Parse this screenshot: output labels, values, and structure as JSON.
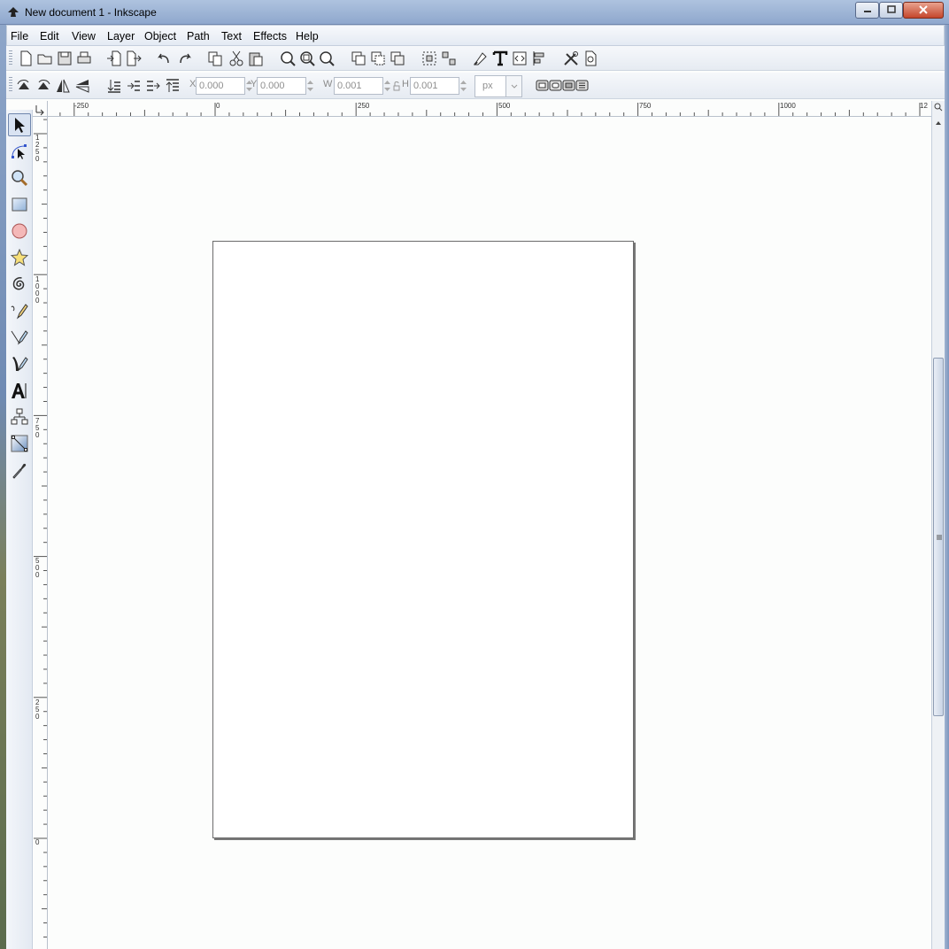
{
  "window": {
    "title": "New document 1 - Inkscape"
  },
  "menu": [
    {
      "label": "File",
      "mnemonic": "F"
    },
    {
      "label": "Edit",
      "mnemonic": "E"
    },
    {
      "label": "View",
      "mnemonic": "V"
    },
    {
      "label": "Layer",
      "mnemonic": "L"
    },
    {
      "label": "Object",
      "mnemonic": "O"
    },
    {
      "label": "Path",
      "mnemonic": "P"
    },
    {
      "label": "Text",
      "mnemonic": "T"
    },
    {
      "label": "Effects",
      "mnemonic": "c"
    },
    {
      "label": "Help",
      "mnemonic": "H"
    }
  ],
  "controls": {
    "x_label": "X",
    "x_value": "0.000",
    "y_label": "Y",
    "y_value": "0.000",
    "w_label": "W",
    "w_value": "0.001",
    "h_label": "H",
    "h_value": "0.001",
    "unit": "px"
  },
  "rulers": {
    "horizontal": [
      "-250",
      "0",
      "250",
      "500",
      "750",
      "1000",
      "12"
    ],
    "vertical": [
      "1250",
      "1000",
      "750",
      "500",
      "250",
      "0"
    ]
  },
  "toolbox_icons": [
    "selector-arrow-icon",
    "node-editor-icon",
    "zoom-icon",
    "rectangle-icon",
    "ellipse-icon",
    "star-icon",
    "spiral-icon",
    "pencil-icon",
    "pen-icon",
    "calligraphy-icon",
    "text-tool-icon",
    "connector-icon",
    "gradient-icon",
    "dropper-icon"
  ]
}
